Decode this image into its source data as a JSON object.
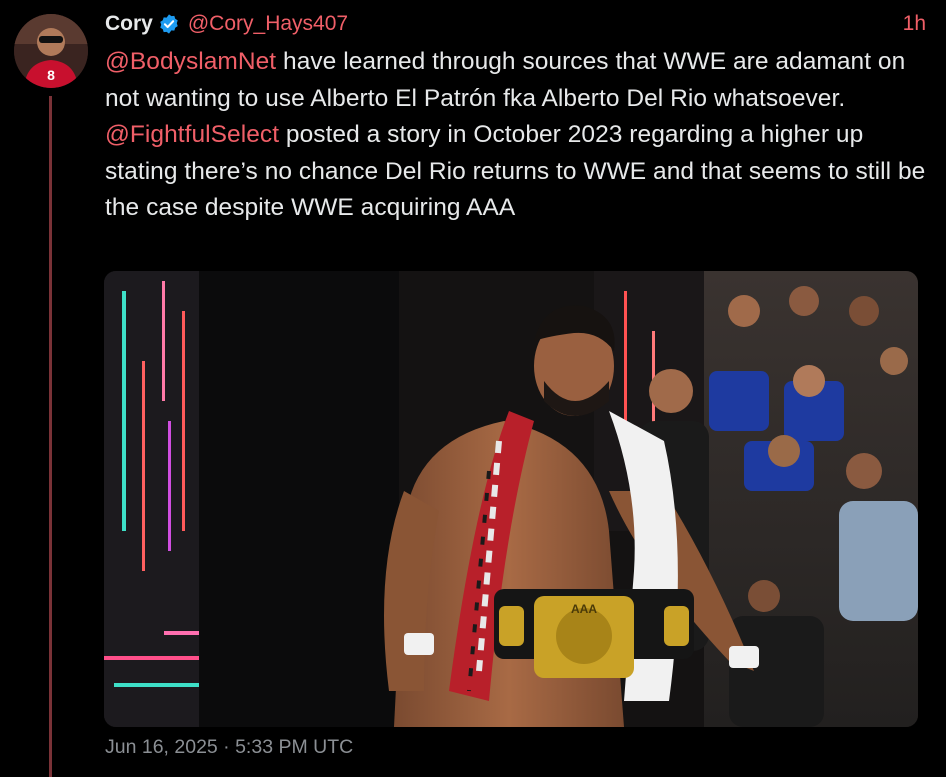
{
  "author": {
    "name": "Cory",
    "handle": "@Cory_Hays407",
    "verified": true,
    "avatar_icon": "avatar-photo"
  },
  "relative_time": "1h",
  "body": {
    "mention1": "@BodyslamNet",
    "text1": " have learned through sources that WWE are adamant on not wanting to use Alberto El Patrón fka Alberto Del Rio whatsoever. ",
    "mention2": "@FightfulSelect",
    "text2": " posted a story in October 2023 regarding a higher up stating there’s no chance Del Rio returns to WWE and that seems to still be the case despite WWE acquiring AAA"
  },
  "media": {
    "belt_text": "AAA"
  },
  "timestamp": "Jun 16, 2025 · 5:33 PM UTC",
  "colors": {
    "accent": "#f05f68",
    "verified": "#1d9bf0",
    "background": "#000000",
    "text": "#e7e9ea",
    "muted": "#8b8f94",
    "thread_line": "#7a3237"
  }
}
